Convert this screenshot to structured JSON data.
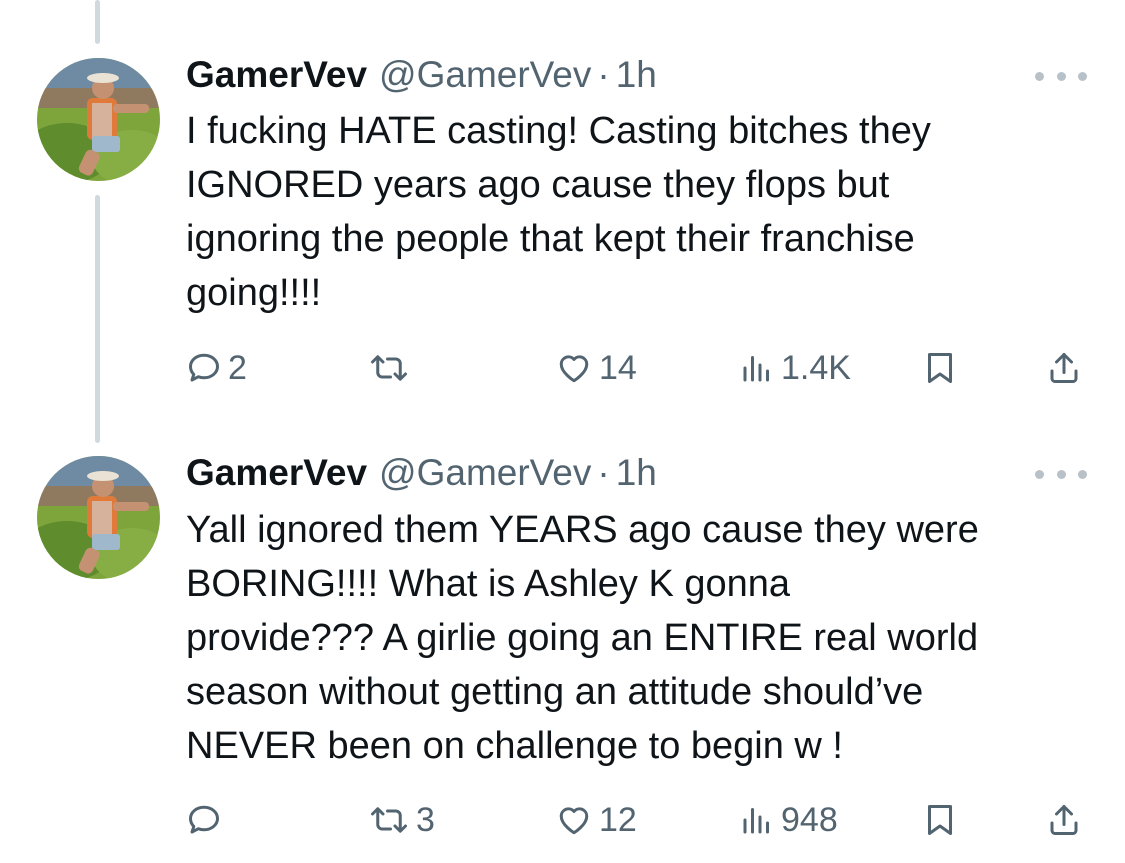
{
  "tweets": [
    {
      "display_name": "GamerVev",
      "handle": "@GamerVev",
      "separator": "·",
      "time": "1h",
      "text_lines": [
        "I fucking HATE casting! Casting bitches they",
        "IGNORED years ago cause they flops but",
        "ignoring the people that kept their franchise",
        "going!!!!"
      ],
      "replies": "2",
      "reposts": "",
      "likes": "14",
      "views": "1.4K"
    },
    {
      "display_name": "GamerVev",
      "handle": "@GamerVev",
      "separator": "·",
      "time": "1h",
      "text_lines": [
        "Yall ignored them YEARS ago cause they were",
        "BORING!!!! What is Ashley K gonna",
        "provide??? A girlie going an ENTIRE real world",
        "season without getting an attitude should’ve",
        "NEVER been on challenge to begin w !"
      ],
      "replies": "",
      "reposts": "3",
      "likes": "12",
      "views": "948"
    }
  ],
  "icons": {
    "reply": "reply-icon",
    "repost": "repost-icon",
    "like": "heart-icon",
    "views": "views-icon",
    "bookmark": "bookmark-icon",
    "share": "share-icon",
    "more": "more-icon"
  },
  "colors": {
    "text_primary": "#0f1419",
    "text_secondary": "#536471",
    "thread_line": "#cfd9de",
    "icon_gray": "#536471"
  }
}
